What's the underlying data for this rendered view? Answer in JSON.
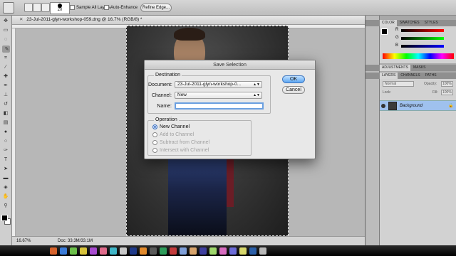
{
  "options_bar": {
    "brush_size": "20",
    "sample_all_layers": "Sample All Layers",
    "auto_enhance": "Auto-Enhance",
    "refine_edge": "Refine Edge..."
  },
  "document": {
    "tab_title": "23-Jul-2011-glyn-workshop-059.dng @ 16.7% (RGB/8) *",
    "zoom": "16.67%",
    "doc_size": "Doc: 33.3M/33.1M"
  },
  "color_panel": {
    "tabs": [
      "COLOR",
      "SWATCHES",
      "STYLES"
    ],
    "channels": [
      "R",
      "G",
      "B"
    ]
  },
  "adjustments_panel": {
    "tabs": [
      "ADJUSTMENTS",
      "MASKS"
    ]
  },
  "layers_panel": {
    "tabs": [
      "LAYERS",
      "CHANNELS",
      "PATHS"
    ],
    "blend_mode": "Normal",
    "opacity_label": "Opacity:",
    "opacity_value": "100%",
    "fill_label": "Fill:",
    "fill_value": "100%",
    "lock_label": "Lock:",
    "layer_name": "Background"
  },
  "dialog": {
    "title": "Save Selection",
    "destination_label": "Destination",
    "document_label": "Document:",
    "document_value": "23-Jul-2011-glyn-workshop-0...",
    "channel_label": "Channel:",
    "channel_value": "New",
    "name_label": "Name:",
    "name_value": "",
    "operation_label": "Operation",
    "operations": [
      {
        "label": "New Channel",
        "selected": true,
        "enabled": true
      },
      {
        "label": "Add to Channel",
        "selected": false,
        "enabled": false
      },
      {
        "label": "Subtract from Channel",
        "selected": false,
        "enabled": false
      },
      {
        "label": "Intersect with Channel",
        "selected": false,
        "enabled": false
      }
    ],
    "ok_label": "OK",
    "cancel_label": "Cancel"
  },
  "colors": {
    "ok_button": "#5da6f2",
    "selected_layer": "#9fc1ee"
  }
}
